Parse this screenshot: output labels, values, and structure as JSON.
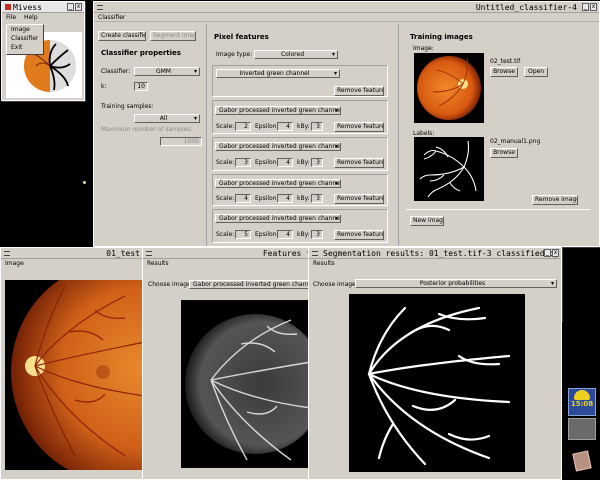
{
  "main_window": {
    "title": "Untitled_classifier-4",
    "menu": "Classifier",
    "buttons": {
      "create_classifier": "Create classifier",
      "segment_image": "Segment image"
    },
    "classifier_properties": {
      "header": "Classifier properties",
      "classifier_label": "Classifier:",
      "classifier_value": "GMM",
      "k_label": "k:",
      "k_value": "10",
      "training_samples_label": "Training samples:",
      "training_samples_value": "All",
      "max_samples_label": "Maximum number of samples:",
      "max_samples_value": "1000"
    },
    "pixel_features": {
      "header": "Pixel features",
      "image_type_label": "Image type:",
      "image_type_value": "Colored",
      "first_feature": "Inverted green channel",
      "remove_label": "Remove feature",
      "gabor_feature": "Gabor processed inverted green channel",
      "scale_label": "Scale:",
      "epsilon_label": "Epsilon:",
      "kby_label": "kBy:",
      "gabor_rows": [
        {
          "scale": "2",
          "epsilon": "4",
          "kby": "3"
        },
        {
          "scale": "3",
          "epsilon": "4",
          "kby": "3"
        },
        {
          "scale": "4",
          "epsilon": "4",
          "kby": "3"
        },
        {
          "scale": "5",
          "epsilon": "4",
          "kby": "3"
        }
      ]
    },
    "training_images": {
      "header": "Training images",
      "image_label": "Image:",
      "image_filename": "02_test.tif",
      "browse": "Browse",
      "open": "Open",
      "labels_label": "Labels:",
      "labels_filename": "02_manual1.png",
      "browse2": "Browse",
      "remove_image": "Remove image",
      "new_image": "New image"
    }
  },
  "launcher_window": {
    "title": "Mivess",
    "menu": [
      "File",
      "Help"
    ],
    "file_menu": [
      "Image",
      "Classifier",
      "Exit"
    ]
  },
  "image_window": {
    "title": "01_test",
    "menu": "Image"
  },
  "features_window": {
    "title": "Features f",
    "menu": "Results",
    "choose_label": "Choose image:",
    "choose_value": "Gabor processed inverted green channel"
  },
  "segmentation_window": {
    "title": "Segmentation results: 01_test.tif-3 classified by d",
    "menu": "Results",
    "choose_label": "Choose image:",
    "choose_value": "Posterior probabilities"
  },
  "tray": {
    "clock": "15:08"
  },
  "colors": {
    "window_bg": "#d4d0c8",
    "retina_orange": "#e07a1c",
    "retina_dark": "#8a3008",
    "desktop": "#000000"
  }
}
